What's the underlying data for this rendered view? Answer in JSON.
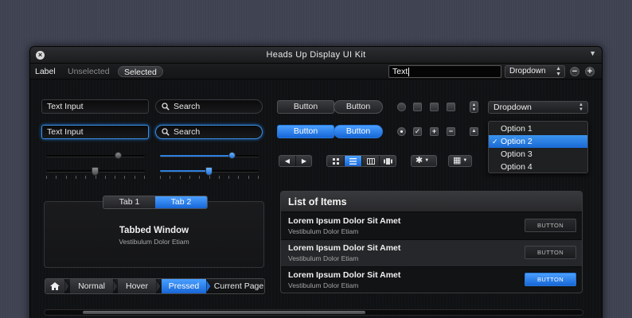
{
  "window": {
    "title": "Heads Up Display UI Kit",
    "close_glyph": "×",
    "menu_glyph": "▼"
  },
  "toolbar": {
    "label": "Label",
    "unselected": "Unselected",
    "selected": "Selected",
    "text_value": "Text",
    "dropdown_value": "Dropdown",
    "minus": "−",
    "plus": "+"
  },
  "inputs": {
    "text_input_1": "Text Input",
    "search_1": "Search",
    "text_input_2": "Text Input",
    "search_2": "Search"
  },
  "buttons": {
    "button_1": "Button",
    "button_2": "Button",
    "button_3": "Button",
    "button_4": "Button"
  },
  "controls": {
    "check_glyph": "✓",
    "plus_glyph": "+",
    "minus_glyph": "−",
    "up_glyph": "▲",
    "down_glyph": "▼"
  },
  "dropdown": {
    "value": "Dropdown",
    "arrows": "▲▼",
    "options": [
      "Option 1",
      "Option 2",
      "Option 3",
      "Option 4"
    ],
    "selected_index": 1,
    "check": "✓"
  },
  "sliders": {
    "left_top": 0.74,
    "right_top": 0.73,
    "left_ticked": 0.49,
    "right_ticked": 0.5,
    "accent": "#2f7fe0"
  },
  "nav": {
    "prev": "◀",
    "next": "▶"
  },
  "view_icons": [
    "grid-view-icon",
    "list-view-icon",
    "column-view-icon",
    "coverflow-view-icon"
  ],
  "gear": {
    "icon": "gear-icon",
    "glyph": "✱",
    "dd": "▼"
  },
  "grid_menu": {
    "icon": "grid-icon",
    "glyph": "▦",
    "dd": "▼"
  },
  "tabs": {
    "tab1": "Tab 1",
    "tab2": "Tab 2",
    "active": 2
  },
  "tabbed_window": {
    "title": "Tabbed Window",
    "subtitle": "Vestibulum Dolor Etiam"
  },
  "breadcrumb": {
    "home_icon": "home-icon",
    "items": [
      "Normal",
      "Hover",
      "Pressed",
      "Current Page"
    ]
  },
  "list": {
    "header": "List of Items",
    "rows": [
      {
        "title": "Lorem Ipsum Dolor Sit Amet",
        "subtitle": "Vestibulum Dolor Etiam",
        "button": "BUTTON"
      },
      {
        "title": "Lorem Ipsum Dolor Sit Amet",
        "subtitle": "Vestibulum Dolor Etiam",
        "button": "BUTTON"
      },
      {
        "title": "Lorem Ipsum Dolor Sit Amet",
        "subtitle": "Vestibulum Dolor Etiam",
        "button": "BUTTON"
      }
    ]
  },
  "colors": {
    "accent_blue": "#1f73d9",
    "background": "#3f4352",
    "panel": "#121315"
  }
}
